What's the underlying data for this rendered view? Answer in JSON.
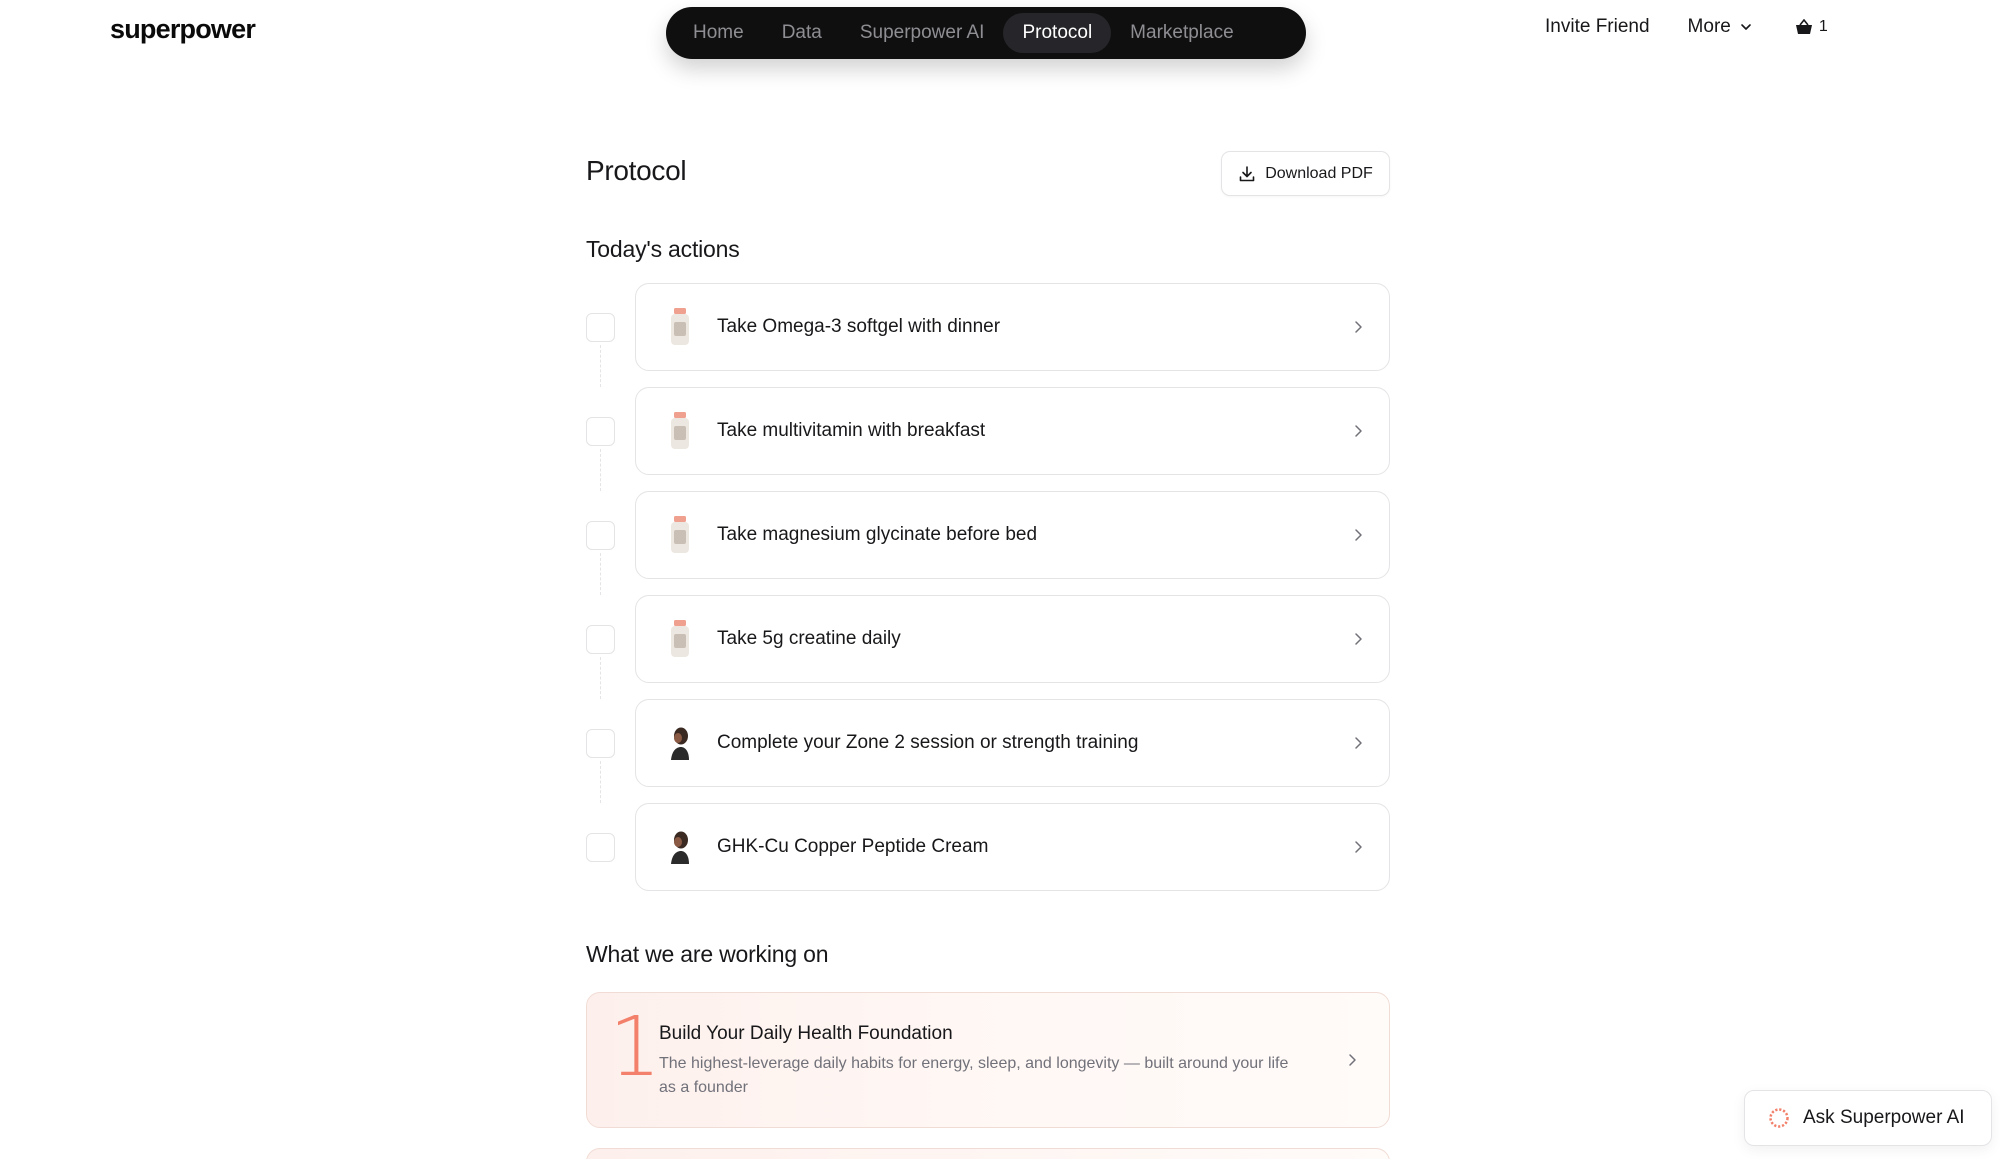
{
  "brand": {
    "logo_text": "superpower"
  },
  "nav": {
    "items": [
      {
        "label": "Home",
        "active": false
      },
      {
        "label": "Data",
        "active": false
      },
      {
        "label": "Superpower AI",
        "active": false
      },
      {
        "label": "Protocol",
        "active": true
      },
      {
        "label": "Marketplace",
        "active": false
      }
    ]
  },
  "header_right": {
    "invite_label": "Invite Friend",
    "more_label": "More",
    "cart_count": "1"
  },
  "page": {
    "title": "Protocol",
    "download_label": "Download PDF"
  },
  "todays_actions": {
    "title": "Today's actions",
    "items": [
      {
        "label": "Take Omega-3 softgel with dinner",
        "icon": "supplement-bottle-icon"
      },
      {
        "label": "Take multivitamin with breakfast",
        "icon": "supplement-bottle-icon"
      },
      {
        "label": "Take magnesium glycinate before bed",
        "icon": "supplement-bottle-icon"
      },
      {
        "label": "Take 5g creatine daily",
        "icon": "supplement-bottle-icon"
      },
      {
        "label": "Complete your Zone 2 session or strength training",
        "icon": "person-avatar-icon"
      },
      {
        "label": "GHK-Cu Copper Peptide Cream",
        "icon": "person-avatar-icon"
      }
    ]
  },
  "working_on": {
    "title": "What we are working on",
    "items": [
      {
        "number": "1",
        "title": "Build Your Daily Health Foundation",
        "description": "The highest-leverage daily habits for energy, sleep, and longevity — built around your life as a founder"
      }
    ]
  },
  "ask_ai": {
    "label": "Ask Superpower AI"
  },
  "colors": {
    "nav_bg": "#0f0f10",
    "accent": "#f2806a",
    "border": "#e4e4e7"
  }
}
